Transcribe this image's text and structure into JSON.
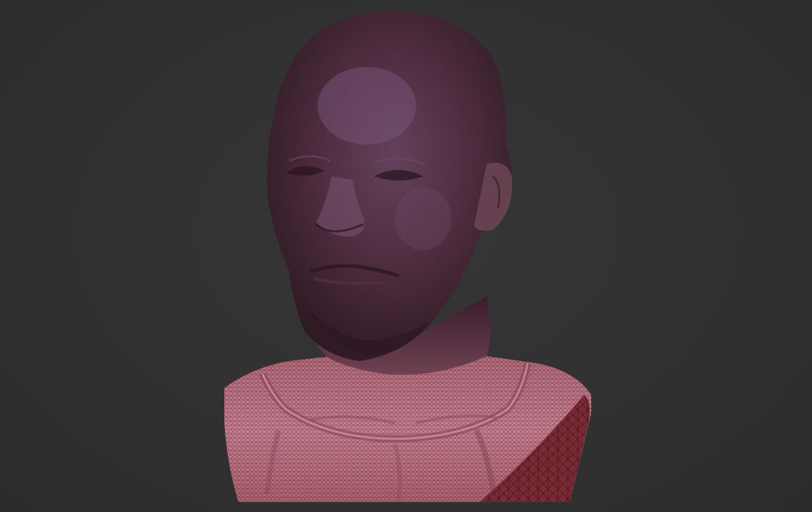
{
  "viewport": {
    "background_color": "#313131",
    "model": {
      "type": "sculpt-bust-wireframe",
      "skin_color": "#c87a88",
      "shadow_color": "#3b2530",
      "cut_face_color": "#7a2a34"
    }
  }
}
